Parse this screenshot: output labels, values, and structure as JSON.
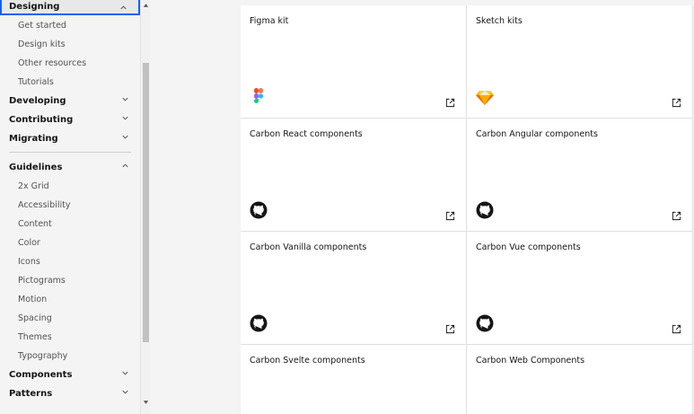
{
  "sidebar": {
    "designing": {
      "label": "Designing",
      "items": [
        "Get started",
        "Design kits",
        "Other resources",
        "Tutorials"
      ]
    },
    "developing": {
      "label": "Developing"
    },
    "contributing": {
      "label": "Contributing"
    },
    "migrating": {
      "label": "Migrating"
    },
    "guidelines": {
      "label": "Guidelines",
      "items": [
        "2x Grid",
        "Accessibility",
        "Content",
        "Color",
        "Icons",
        "Pictograms",
        "Motion",
        "Spacing",
        "Themes",
        "Typography"
      ]
    },
    "components": {
      "label": "Components"
    },
    "patterns": {
      "label": "Patterns"
    }
  },
  "tiles": [
    {
      "title": "Figma kit",
      "icon": "figma-icon"
    },
    {
      "title": "Sketch kits",
      "icon": "sketch-icon"
    },
    {
      "title": "Carbon React components",
      "icon": "github-icon"
    },
    {
      "title": "Carbon Angular components",
      "icon": "github-icon"
    },
    {
      "title": "Carbon Vanilla components",
      "icon": "github-icon"
    },
    {
      "title": "Carbon Vue components",
      "icon": "github-icon"
    },
    {
      "title": "Carbon Svelte components",
      "icon": "github-icon"
    },
    {
      "title": "Carbon Web Components",
      "icon": "github-icon"
    }
  ],
  "colors": {
    "focus": "#0f62fe",
    "background": "#f4f4f4",
    "tile": "#ffffff"
  }
}
